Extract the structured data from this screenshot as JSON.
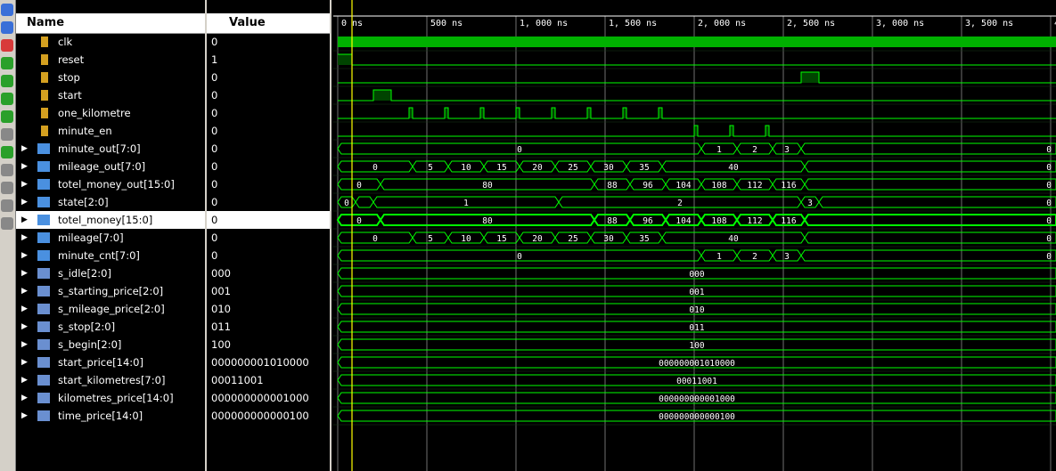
{
  "toolbar": {
    "icons": [
      "zoom-in-icon",
      "zoom-fit-icon",
      "zoom-out-icon",
      "go-start-icon",
      "go-end-icon",
      "prev-transition-icon",
      "next-transition-icon",
      "add-marker-icon",
      "prev-marker-icon",
      "next-marker-icon",
      "swap-cursors-icon",
      "snap-transition-icon",
      "expand-icon"
    ]
  },
  "header": {
    "name_label": "Name",
    "value_label": "Value"
  },
  "timeline": {
    "ticks": [
      "0 ns",
      "500 ns",
      "1, 000 ns",
      "1, 500 ns",
      "2, 000 ns",
      "2, 500 ns",
      "3, 000 ns",
      "3, 500 ns",
      "4"
    ]
  },
  "signals": [
    {
      "name": "clk",
      "value": "0",
      "kind": "bit",
      "expandable": false
    },
    {
      "name": "reset",
      "value": "1",
      "kind": "bit",
      "expandable": false
    },
    {
      "name": "stop",
      "value": "0",
      "kind": "bit",
      "expandable": false
    },
    {
      "name": "start",
      "value": "0",
      "kind": "bit",
      "expandable": false
    },
    {
      "name": "one_kilometre",
      "value": "0",
      "kind": "bit",
      "expandable": false
    },
    {
      "name": "minute_en",
      "value": "0",
      "kind": "bit",
      "expandable": false
    },
    {
      "name": "minute_out[7:0]",
      "value": "0",
      "kind": "bus-out",
      "expandable": true
    },
    {
      "name": "mileage_out[7:0]",
      "value": "0",
      "kind": "bus-out",
      "expandable": true
    },
    {
      "name": "totel_money_out[15:0]",
      "value": "0",
      "kind": "bus-out",
      "expandable": true
    },
    {
      "name": "state[2:0]",
      "value": "0",
      "kind": "bus-reg",
      "expandable": true
    },
    {
      "name": "totel_money[15:0]",
      "value": "0",
      "kind": "bus-reg",
      "expandable": true,
      "selected": true
    },
    {
      "name": "mileage[7:0]",
      "value": "0",
      "kind": "bus-reg",
      "expandable": true
    },
    {
      "name": "minute_cnt[7:0]",
      "value": "0",
      "kind": "bus-reg",
      "expandable": true
    },
    {
      "name": "s_idle[2:0]",
      "value": "000",
      "kind": "param",
      "expandable": true
    },
    {
      "name": "s_starting_price[2:0]",
      "value": "001",
      "kind": "param",
      "expandable": true
    },
    {
      "name": "s_mileage_price[2:0]",
      "value": "010",
      "kind": "param",
      "expandable": true
    },
    {
      "name": "s_stop[2:0]",
      "value": "011",
      "kind": "param",
      "expandable": true
    },
    {
      "name": "s_begin[2:0]",
      "value": "100",
      "kind": "param",
      "expandable": true
    },
    {
      "name": "start_price[14:0]",
      "value": "000000001010000",
      "kind": "param",
      "expandable": true
    },
    {
      "name": "start_kilometres[7:0]",
      "value": "00011001",
      "kind": "param",
      "expandable": true
    },
    {
      "name": "kilometres_price[14:0]",
      "value": "000000000001000",
      "kind": "param",
      "expandable": true
    },
    {
      "name": "time_price[14:0]",
      "value": "000000000000100",
      "kind": "param",
      "expandable": true
    }
  ],
  "waves": {
    "clk": {
      "type": "clock"
    },
    "reset": {
      "type": "bit",
      "init": 1,
      "edges": [
        80
      ]
    },
    "stop": {
      "type": "bit",
      "init": 0,
      "edges": [
        2600,
        2700
      ]
    },
    "start": {
      "type": "bit",
      "init": 0,
      "edges": [
        200,
        300
      ]
    },
    "one_kilometre": {
      "type": "bit",
      "init": 0,
      "edges": [
        400,
        420,
        600,
        620,
        800,
        820,
        1000,
        1020,
        1200,
        1220,
        1400,
        1420,
        1600,
        1620,
        1800,
        1820
      ]
    },
    "minute_en": {
      "type": "bit",
      "init": 0,
      "edges": [
        2000,
        2020,
        2200,
        2220,
        2400,
        2420
      ]
    },
    "minute_out[7:0]": {
      "type": "bus",
      "segments": [
        [
          0,
          "0"
        ],
        [
          2040,
          "1"
        ],
        [
          2240,
          "2"
        ],
        [
          2440,
          "3"
        ],
        [
          2600,
          "0"
        ]
      ]
    },
    "mileage_out[7:0]": {
      "type": "bus",
      "segments": [
        [
          0,
          "0"
        ],
        [
          420,
          "5"
        ],
        [
          620,
          "10"
        ],
        [
          820,
          "15"
        ],
        [
          1020,
          "20"
        ],
        [
          1220,
          "25"
        ],
        [
          1420,
          "30"
        ],
        [
          1620,
          "35"
        ],
        [
          1820,
          "40"
        ],
        [
          2620,
          "0"
        ]
      ]
    },
    "totel_money_out[15:0]": {
      "type": "bus",
      "segments": [
        [
          0,
          "0"
        ],
        [
          240,
          "80"
        ],
        [
          1440,
          "88"
        ],
        [
          1640,
          "96"
        ],
        [
          1840,
          "104"
        ],
        [
          2040,
          "108"
        ],
        [
          2240,
          "112"
        ],
        [
          2440,
          "116"
        ],
        [
          2620,
          "0"
        ]
      ]
    },
    "state[2:0]": {
      "type": "bus",
      "segments": [
        [
          0,
          "0"
        ],
        [
          100,
          ""
        ],
        [
          200,
          "1"
        ],
        [
          1240,
          "2"
        ],
        [
          2600,
          "3"
        ],
        [
          2700,
          "0"
        ]
      ]
    },
    "totel_money[15:0]": {
      "type": "bus",
      "bold": true,
      "segments": [
        [
          0,
          "0"
        ],
        [
          240,
          "80"
        ],
        [
          1440,
          "88"
        ],
        [
          1640,
          "96"
        ],
        [
          1840,
          "104"
        ],
        [
          2040,
          "108"
        ],
        [
          2240,
          "112"
        ],
        [
          2440,
          "116"
        ],
        [
          2620,
          "0"
        ]
      ]
    },
    "mileage[7:0]": {
      "type": "bus",
      "segments": [
        [
          0,
          "0"
        ],
        [
          420,
          "5"
        ],
        [
          620,
          "10"
        ],
        [
          820,
          "15"
        ],
        [
          1020,
          "20"
        ],
        [
          1220,
          "25"
        ],
        [
          1420,
          "30"
        ],
        [
          1620,
          "35"
        ],
        [
          1820,
          "40"
        ],
        [
          2620,
          "0"
        ]
      ]
    },
    "minute_cnt[7:0]": {
      "type": "bus",
      "segments": [
        [
          0,
          "0"
        ],
        [
          2040,
          "1"
        ],
        [
          2240,
          "2"
        ],
        [
          2440,
          "3"
        ],
        [
          2600,
          "0"
        ]
      ]
    },
    "s_idle[2:0]": {
      "type": "bus",
      "segments": [
        [
          0,
          "000"
        ]
      ]
    },
    "s_starting_price[2:0]": {
      "type": "bus",
      "segments": [
        [
          0,
          "001"
        ]
      ]
    },
    "s_mileage_price[2:0]": {
      "type": "bus",
      "segments": [
        [
          0,
          "010"
        ]
      ]
    },
    "s_stop[2:0]": {
      "type": "bus",
      "segments": [
        [
          0,
          "011"
        ]
      ]
    },
    "s_begin[2:0]": {
      "type": "bus",
      "segments": [
        [
          0,
          "100"
        ]
      ]
    },
    "start_price[14:0]": {
      "type": "bus",
      "segments": [
        [
          0,
          "000000001010000"
        ]
      ]
    },
    "start_kilometres[7:0]": {
      "type": "bus",
      "segments": [
        [
          0,
          "00011001"
        ]
      ]
    },
    "kilometres_price[14:0]": {
      "type": "bus",
      "segments": [
        [
          0,
          "000000000001000"
        ]
      ]
    },
    "time_price[14:0]": {
      "type": "bus",
      "segments": [
        [
          0,
          "000000000000100"
        ]
      ]
    }
  },
  "colors": {
    "wave": "#00ff00",
    "wave_fill": "#004400",
    "grid": "#d0d0d0",
    "cursor": "#ffff00",
    "header_text": "#ffffff"
  }
}
